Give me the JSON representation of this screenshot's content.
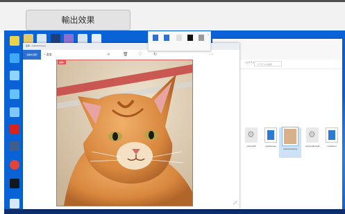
{
  "top": {
    "output_button": "輸出效果"
  },
  "viewer": {
    "title": "画像 - catselected.jpg",
    "tab": "画像を選択",
    "add": "追加",
    "selection_tag": "画像1"
  },
  "ribbon": {
    "items": [
      "",
      "",
      "",
      "",
      ""
    ]
  },
  "explorer": {
    "crumb": "> ピクチャ",
    "search": "ピクチャの検索",
    "files": [
      {
        "label": "picture1B"
      },
      {
        "label": "dueliwisnao"
      },
      {
        "label": "catselected.jpg"
      },
      {
        "label": "pictureHE1LoB"
      },
      {
        "label": "cxelitlorex"
      }
    ]
  }
}
